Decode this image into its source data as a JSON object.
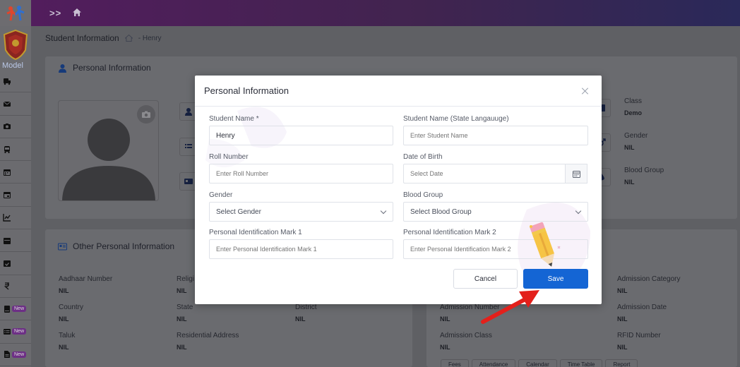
{
  "sidebar": {
    "school_name": "Model",
    "items": [
      {
        "icon": "bus-icon"
      },
      {
        "icon": "mail-icon"
      },
      {
        "icon": "camera-icon"
      },
      {
        "icon": "transport-icon"
      },
      {
        "icon": "calendar-icon"
      },
      {
        "icon": "calendar-event-icon"
      },
      {
        "icon": "chart-icon"
      },
      {
        "icon": "calendar-day-icon"
      },
      {
        "icon": "calendar-check-icon"
      },
      {
        "icon": "rupee-icon"
      },
      {
        "icon": "book-icon",
        "badge": "New"
      },
      {
        "icon": "list-icon",
        "badge": "New"
      },
      {
        "icon": "file-icon",
        "badge": "New"
      }
    ]
  },
  "breadcrumb": {
    "title": "Student Information",
    "crumb": "- Henry"
  },
  "background": {
    "personal_title": "Personal Information",
    "fields_right": [
      {
        "label": "Class",
        "value": "Demo"
      },
      {
        "label": "Gender",
        "value": "NIL"
      },
      {
        "label": "Blood Group",
        "value": "NIL"
      }
    ],
    "other_title": "Other Personal Information",
    "other_fields": [
      {
        "label": "Aadhaar Number",
        "value": "NIL"
      },
      {
        "label": "Religi",
        "value": "NIL"
      },
      {
        "label": "Country",
        "value": "NIL"
      },
      {
        "label": "State",
        "value": "NIL"
      },
      {
        "label": "District",
        "value": "NIL"
      },
      {
        "label": "Taluk",
        "value": "NIL"
      },
      {
        "label": "Residential Address",
        "value": "NIL"
      }
    ],
    "admission_fields": [
      {
        "label": "Admission Category",
        "value": "NIL"
      },
      {
        "label": "Admission Number",
        "value": "NIL"
      },
      {
        "label": "Admission Date",
        "value": "NIL"
      },
      {
        "label": "Admission Class",
        "value": "NIL"
      },
      {
        "label": "RFID Number",
        "value": "NIL"
      }
    ],
    "tabs": [
      "Fees",
      "Attendance",
      "Calendar",
      "Time Table",
      "Report"
    ]
  },
  "modal": {
    "title": "Personal Information",
    "student_name_label": "Student Name *",
    "student_name_value": "Henry",
    "state_name_label": "Student Name (State Langauuge)",
    "state_name_placeholder": "Enter Student Name",
    "roll_label": "Roll Number",
    "roll_placeholder": "Enter Roll Number",
    "dob_label": "Date of Birth",
    "dob_placeholder": "Select Date",
    "gender_label": "Gender",
    "gender_value": "Select Gender",
    "blood_label": "Blood Group",
    "blood_value": "Select Blood Group",
    "mark1_label": "Personal Identification Mark 1",
    "mark1_placeholder": "Enter Personal Identification Mark 1",
    "mark2_label": "Personal Identification Mark 2",
    "mark2_placeholder": "Enter Personal Identification Mark 2",
    "cancel_label": "Cancel",
    "save_label": "Save"
  },
  "colors": {
    "accent": "#1465d4",
    "topbar_start": "#521d5d",
    "topbar_end": "#2a2959",
    "annotation_arrow": "#e3201b"
  }
}
